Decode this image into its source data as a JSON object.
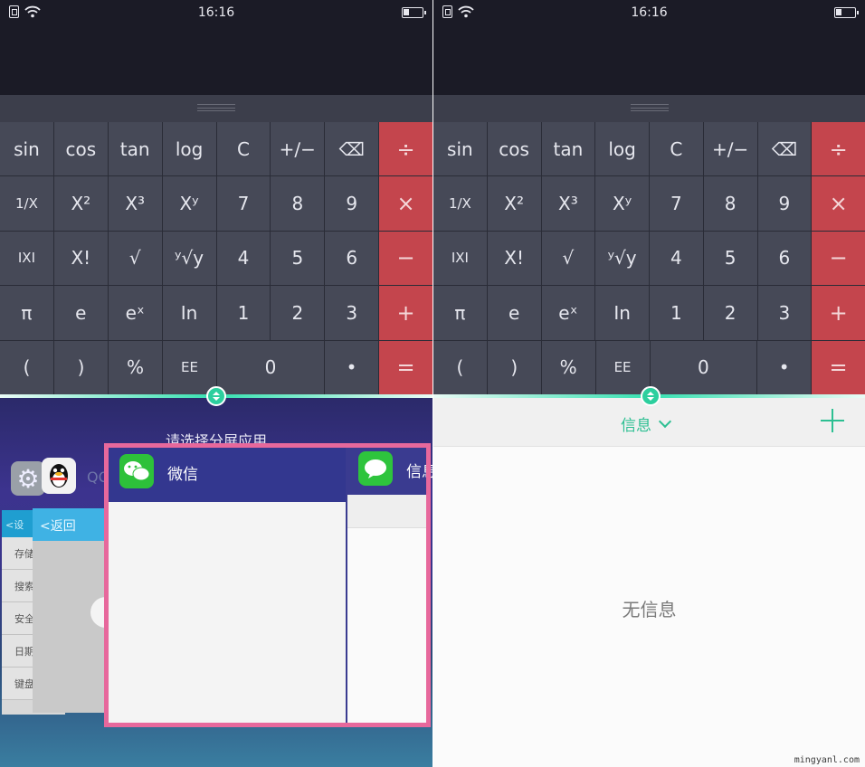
{
  "status_bar": {
    "time": "16:16"
  },
  "calculator": {
    "rows": [
      [
        "sin",
        "cos",
        "tan",
        "log",
        "C",
        "+∕−",
        "⌫",
        "÷"
      ],
      [
        "1/X",
        "X²",
        "X³",
        "Xʸ",
        "7",
        "8",
        "9",
        "×"
      ],
      [
        "IXI",
        "X!",
        "√",
        "ʸ√y",
        "4",
        "5",
        "6",
        "−"
      ],
      [
        "π",
        "e",
        "eˣ",
        "In",
        "1",
        "2",
        "3",
        "+"
      ],
      [
        "(",
        ")",
        "%",
        "EE",
        "0",
        "•",
        "="
      ]
    ]
  },
  "split_picker": {
    "title": "请选择分屏应用",
    "qq_label": "QQ",
    "settings_back_label": "<设",
    "back_label": "返回",
    "settings_rows": [
      "存储",
      "搜索",
      "安全",
      "日期",
      "键盘"
    ],
    "apps": [
      {
        "name": "微信",
        "icon": "wechat-icon"
      },
      {
        "name": "信息",
        "icon": "message-icon"
      }
    ]
  },
  "messages_app": {
    "title": "信息",
    "empty_text": "无信息"
  },
  "colors": {
    "operator_key": "#c4454d",
    "number_key": "#464957",
    "accent_green": "#2cbf92",
    "selection_frame": "#e7689c"
  },
  "watermark": "mingyanl.com"
}
